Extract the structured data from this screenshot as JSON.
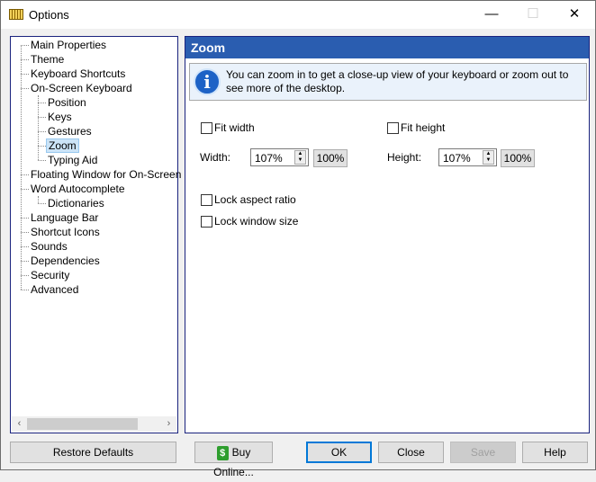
{
  "window": {
    "title": "Options",
    "minimize": "—",
    "maximize": "☐",
    "close": "✕"
  },
  "tree": {
    "items": [
      {
        "label": "Main Properties",
        "level": 0
      },
      {
        "label": "Theme",
        "level": 0
      },
      {
        "label": "Keyboard Shortcuts",
        "level": 0
      },
      {
        "label": "On-Screen Keyboard",
        "level": 0
      },
      {
        "label": "Position",
        "level": 1
      },
      {
        "label": "Keys",
        "level": 1
      },
      {
        "label": "Gestures",
        "level": 1
      },
      {
        "label": "Zoom",
        "level": 1,
        "selected": true
      },
      {
        "label": "Typing Aid",
        "level": 1
      },
      {
        "label": "Floating Window for On-Screen Keyboard",
        "level": 0
      },
      {
        "label": "Word Autocomplete",
        "level": 0
      },
      {
        "label": "Dictionaries",
        "level": 1
      },
      {
        "label": "Language Bar",
        "level": 0
      },
      {
        "label": "Shortcut Icons",
        "level": 0
      },
      {
        "label": "Sounds",
        "level": 0
      },
      {
        "label": "Dependencies",
        "level": 0
      },
      {
        "label": "Security",
        "level": 0
      },
      {
        "label": "Advanced",
        "level": 0
      }
    ],
    "scroll_left": "‹",
    "scroll_right": "›"
  },
  "panel": {
    "title": "Zoom",
    "info": "You can zoom in to get a close-up view of your keyboard or zoom out to see more of the desktop.",
    "fit_width": "Fit width",
    "fit_height": "Fit height",
    "width_label": "Width:",
    "width_value": "107%",
    "width_reset": "100%",
    "height_label": "Height:",
    "height_value": "107%",
    "height_reset": "100%",
    "lock_aspect": "Lock aspect ratio",
    "lock_window": "Lock window size"
  },
  "buttons": {
    "restore": "Restore Defaults",
    "buy": "Buy Online...",
    "ok": "OK",
    "close": "Close",
    "save": "Save",
    "help": "Help"
  }
}
